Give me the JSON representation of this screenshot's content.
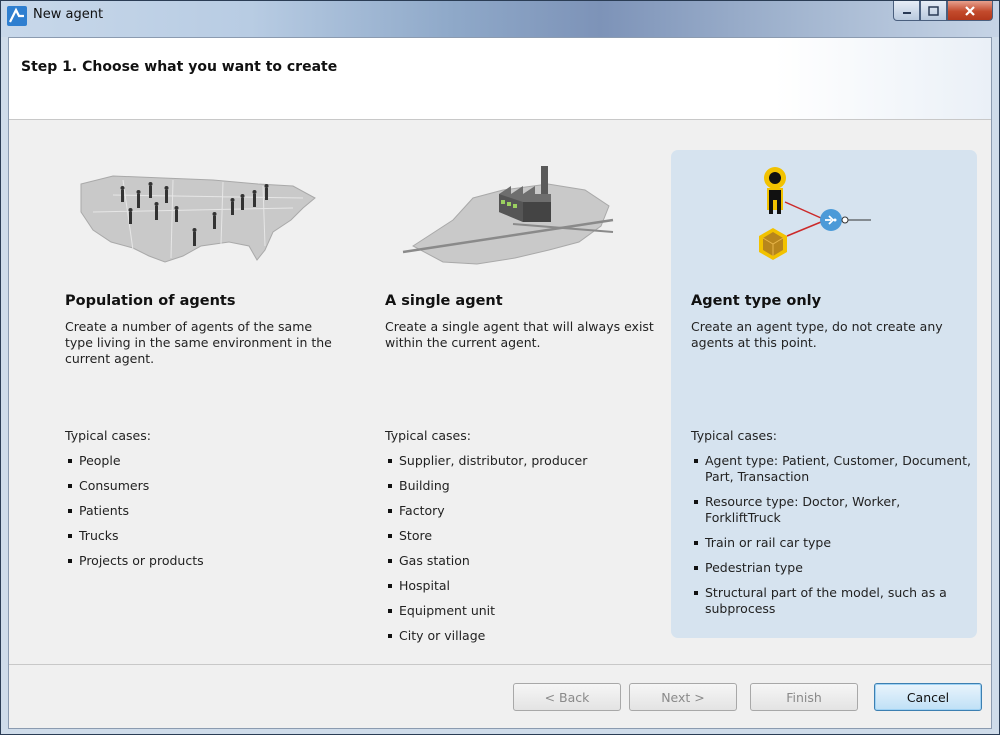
{
  "window": {
    "title": "New agent",
    "controls": {
      "minimize": "–",
      "maximize": "□",
      "close": "x"
    }
  },
  "header": {
    "step_title": "Step 1. Choose what you want to create"
  },
  "options": [
    {
      "title": "Population of agents",
      "description": "Create a number of agents of the same type living in the same environment in the current agent.",
      "typical_label": "Typical cases:",
      "cases": [
        "People",
        "Consumers",
        "Patients",
        "Trucks",
        "Projects or products"
      ],
      "illustration": "us-map-population-icon"
    },
    {
      "title": "A single agent",
      "description": "Create a single agent that will always exist within the current agent.",
      "typical_label": "Typical cases:",
      "cases": [
        "Supplier, distributor, producer",
        "Building",
        "Factory",
        "Store",
        "Gas station",
        "Hospital",
        "Equipment unit",
        "City or village"
      ],
      "illustration": "factory-on-map-icon"
    },
    {
      "title": "Agent type only",
      "description": "Create an agent type, do not create any agents at this point.",
      "typical_label": "Typical cases:",
      "cases": [
        "Agent type: Patient, Customer, Document, Part, Transaction",
        "Resource type: Doctor, Worker, ForkliftTruck",
        "Train or rail car type",
        "Pedestrian type",
        "Structural part of the model, such as a subprocess"
      ],
      "illustration": "agent-type-diagram-icon",
      "selected": true
    }
  ],
  "buttons": {
    "back": "< Back",
    "next": "Next >",
    "finish": "Finish",
    "cancel": "Cancel"
  },
  "colors": {
    "selected_panel": "#d6e3ef",
    "cancel_border": "#3c7fb1"
  }
}
